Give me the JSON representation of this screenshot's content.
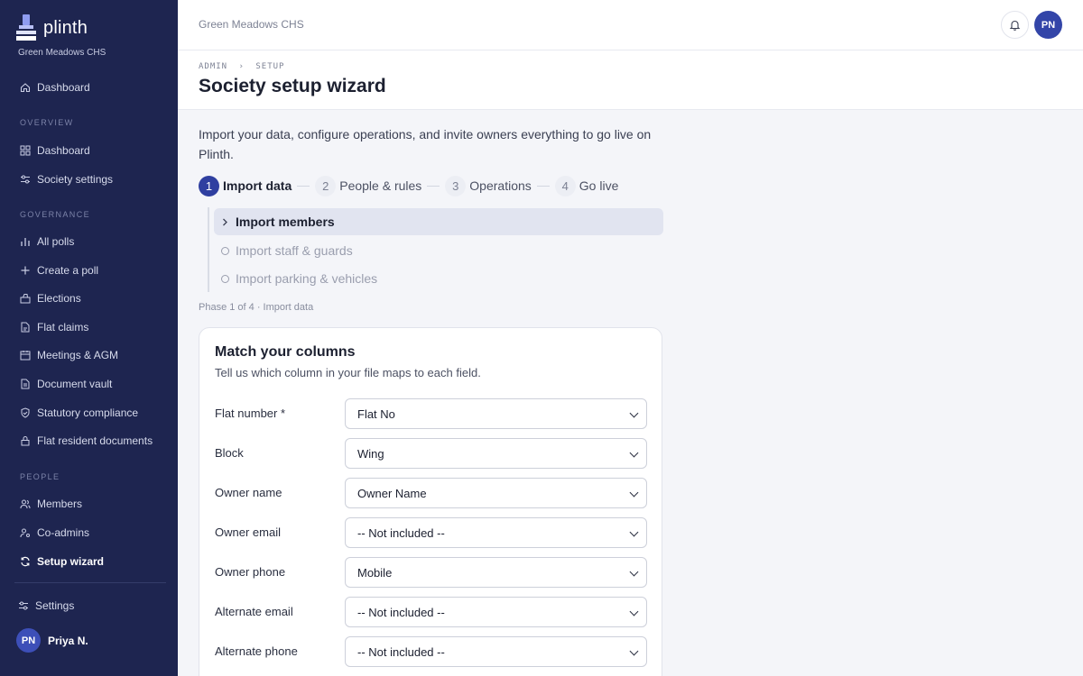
{
  "brand": {
    "name": "plinth",
    "society": "Green Meadows CHS"
  },
  "sidebar": {
    "top_item": {
      "label": "Dashboard",
      "icon": "home-icon"
    },
    "sections": [
      {
        "title": "OVERVIEW",
        "items": [
          {
            "label": "Dashboard",
            "icon": "grid-icon"
          },
          {
            "label": "Society settings",
            "icon": "sliders-icon"
          }
        ]
      },
      {
        "title": "GOVERNANCE",
        "items": [
          {
            "label": "All polls",
            "icon": "bar-chart-icon"
          },
          {
            "label": "Create a poll",
            "icon": "plus-icon"
          },
          {
            "label": "Elections",
            "icon": "ballot-icon"
          },
          {
            "label": "Flat claims",
            "icon": "file-icon"
          },
          {
            "label": "Meetings & AGM",
            "icon": "calendar-icon"
          },
          {
            "label": "Document vault",
            "icon": "document-icon"
          },
          {
            "label": "Statutory compliance",
            "icon": "shield-icon"
          },
          {
            "label": "Flat resident documents",
            "icon": "lock-icon"
          }
        ]
      },
      {
        "title": "PEOPLE",
        "items": [
          {
            "label": "Members",
            "icon": "users-icon"
          },
          {
            "label": "Co-admins",
            "icon": "user-key-icon"
          },
          {
            "label": "Setup wizard",
            "icon": "refresh-icon",
            "active": true
          }
        ]
      }
    ],
    "settings_label": "Settings",
    "user": {
      "initials": "PN",
      "name": "Priya N."
    }
  },
  "topbar": {
    "title": "Green Meadows CHS",
    "avatar_initials": "PN"
  },
  "header": {
    "breadcrumb": [
      "ADMIN",
      "SETUP"
    ],
    "breadcrumb_sep": "›",
    "title": "Society setup wizard"
  },
  "intro": "Import your data, configure operations, and invite owners everything to go live on Plinth.",
  "steps": [
    {
      "num": "1",
      "label": "Import data",
      "current": true
    },
    {
      "num": "2",
      "label": "People & rules"
    },
    {
      "num": "3",
      "label": "Operations"
    },
    {
      "num": "4",
      "label": "Go live"
    }
  ],
  "substeps": [
    {
      "label": "Import members",
      "active": true
    },
    {
      "label": "Import staff & guards"
    },
    {
      "label": "Import parking & vehicles"
    }
  ],
  "phase_text": "Phase 1 of 4 · Import data",
  "card": {
    "title": "Match your columns",
    "subtitle": "Tell us which column in your file maps to each field.",
    "fields": [
      {
        "label": "Flat number *",
        "value": "Flat No"
      },
      {
        "label": "Block",
        "value": "Wing"
      },
      {
        "label": "Owner name",
        "value": "Owner Name"
      },
      {
        "label": "Owner email",
        "value": "-- Not included --"
      },
      {
        "label": "Owner phone",
        "value": "Mobile"
      },
      {
        "label": "Alternate email",
        "value": "-- Not included --"
      },
      {
        "label": "Alternate phone",
        "value": "-- Not included --"
      }
    ]
  },
  "colors": {
    "sidebar": "#1e2550",
    "accent": "#2f3fa0"
  }
}
